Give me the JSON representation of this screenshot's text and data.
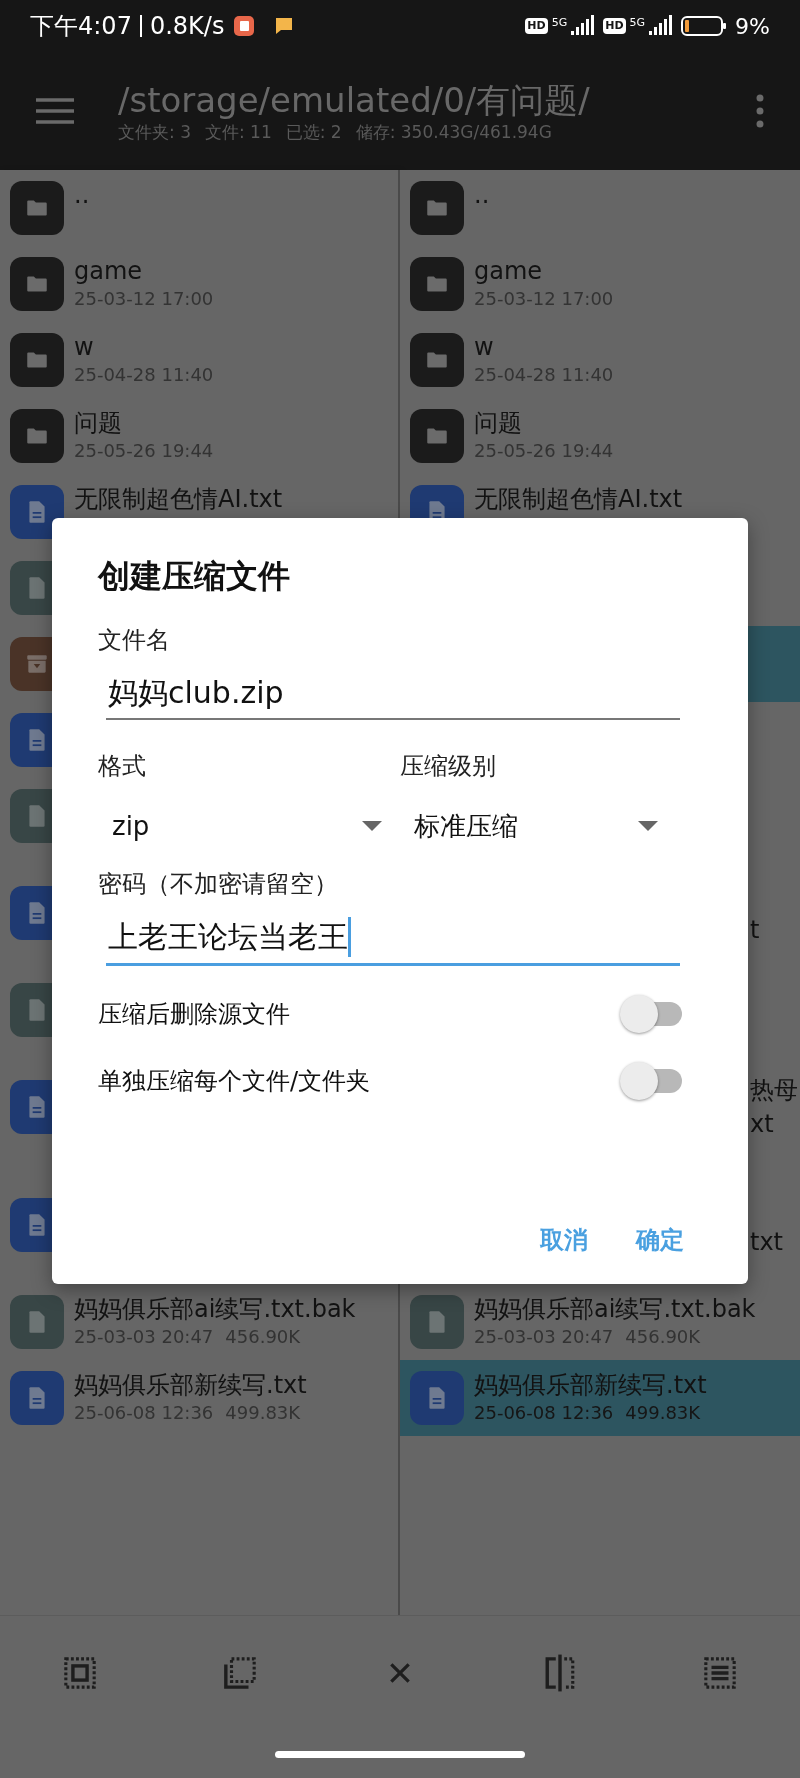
{
  "status_bar": {
    "time": "下午4:07",
    "speed": "0.8K/s",
    "sims": [
      {
        "hd": "HD",
        "net": "5G"
      },
      {
        "hd": "HD",
        "net": "5G"
      }
    ],
    "battery": "9%"
  },
  "app_bar": {
    "path": "/storage/emulated/0/有问题/",
    "stats": [
      "文件夹: 3",
      "文件: 11",
      "已选: 2",
      "储存: 350.43G/461.94G"
    ]
  },
  "panes": [
    {
      "rows": [
        {
          "kind": "folder",
          "name": "..",
          "selected": false
        },
        {
          "kind": "folder",
          "name": "game",
          "date": "25-03-12 17:00",
          "selected": false
        },
        {
          "kind": "folder",
          "name": "w",
          "date": "25-04-28 11:40",
          "selected": false
        },
        {
          "kind": "folder",
          "name": "问题",
          "date": "25-05-26 19:44",
          "selected": false
        },
        {
          "kind": "text",
          "name": "无限制超色情AI.txt",
          "selected": false
        },
        {
          "kind": "file",
          "selected": false
        },
        {
          "kind": "archive",
          "selected": false
        },
        {
          "kind": "text",
          "selected": false
        },
        {
          "kind": "file",
          "selected": false
        },
        {
          "kind": "text",
          "wrapped": true,
          "selected": false
        },
        {
          "kind": "file",
          "selected": false
        },
        {
          "kind": "text",
          "wrapped": true,
          "selected": false
        },
        {
          "kind": "text",
          "wrapped": true,
          "selected": false
        },
        {
          "kind": "file",
          "name": "妈妈俱乐部ai续写.txt.bak",
          "date": "25-03-03 20:47",
          "size": "456.90K",
          "selected": false
        },
        {
          "kind": "text",
          "name": "妈妈俱乐部新续写.txt",
          "date": "25-06-08 12:36",
          "size": "499.83K",
          "selected": false
        }
      ]
    },
    {
      "rows": [
        {
          "kind": "folder",
          "name": "..",
          "selected": false
        },
        {
          "kind": "folder",
          "name": "game",
          "date": "25-03-12 17:00",
          "selected": false
        },
        {
          "kind": "folder",
          "name": "w",
          "date": "25-04-28 11:40",
          "selected": false
        },
        {
          "kind": "folder",
          "name": "问题",
          "date": "25-05-26 19:44",
          "selected": false
        },
        {
          "kind": "text",
          "name": "无限制超色情AI.txt",
          "selected": false
        },
        {},
        {
          "selected": true
        },
        {},
        {},
        {
          "wrapped": true,
          "tails": [
            "t"
          ],
          "selected": false
        },
        {},
        {
          "wrapped": true,
          "tails": [
            "热母",
            "xt"
          ],
          "selected": false
        },
        {
          "wrapped": true,
          "tails": [
            "txt"
          ],
          "selected": false
        },
        {
          "kind": "file",
          "name": "妈妈俱乐部ai续写.txt.bak",
          "date": "25-03-03 20:47",
          "size": "456.90K",
          "selected": false
        },
        {
          "kind": "text",
          "name": "妈妈俱乐部新续写.txt",
          "date": "25-06-08 12:36",
          "size": "499.83K",
          "selected": true
        }
      ]
    }
  ],
  "dialog": {
    "title": "创建压缩文件",
    "filename": {
      "label": "文件名",
      "value": "妈妈club.zip",
      "focused": false
    },
    "selects": [
      {
        "label": "格式",
        "value": "zip"
      },
      {
        "label": "压缩级别",
        "value": "标准压缩"
      }
    ],
    "password": {
      "label": "密码（不加密请留空）",
      "value": "上老王论坛当老王",
      "focused": true
    },
    "switches": [
      {
        "label": "压缩后删除源文件",
        "on": false
      },
      {
        "label": "单独压缩每个文件/文件夹",
        "on": false
      }
    ],
    "buttons": [
      "取消",
      "确定"
    ]
  },
  "toolbar": [
    {
      "kind": "select-all"
    },
    {
      "kind": "select-range"
    },
    {
      "kind": "close"
    },
    {
      "kind": "invert"
    },
    {
      "kind": "list-select"
    }
  ]
}
